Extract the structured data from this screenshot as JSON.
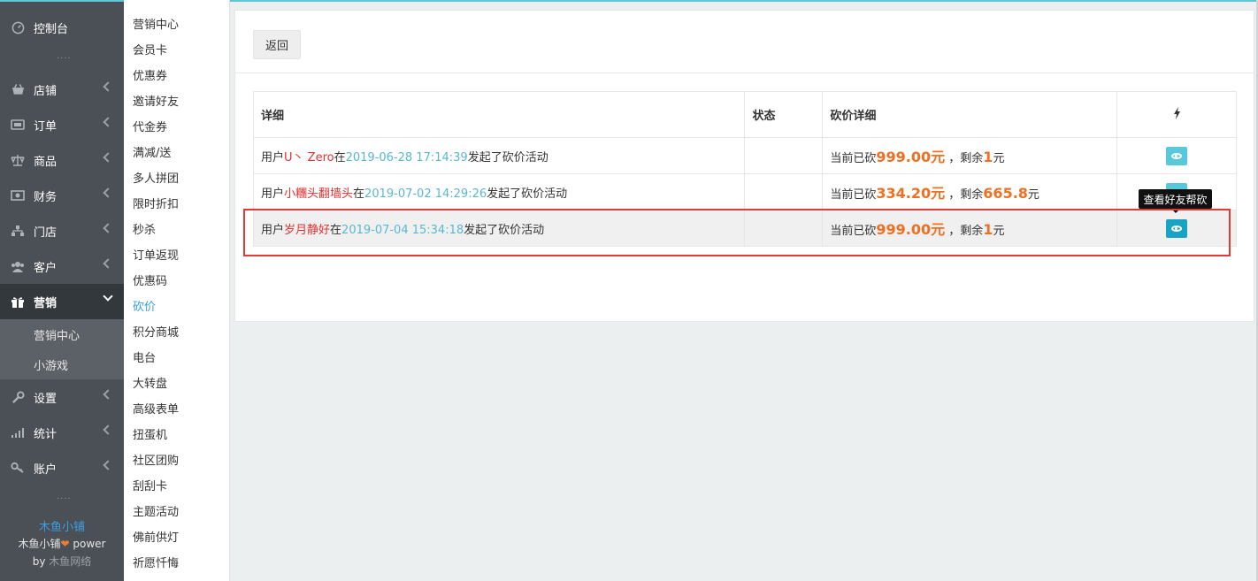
{
  "sidebar": {
    "dashboard": {
      "label": "控制台",
      "icon": "dashboard-icon"
    },
    "items": [
      {
        "label": "店铺",
        "icon": "shop-icon"
      },
      {
        "label": "订单",
        "icon": "order-icon"
      },
      {
        "label": "商品",
        "icon": "goods-icon"
      },
      {
        "label": "财务",
        "icon": "finance-icon"
      },
      {
        "label": "门店",
        "icon": "store-icon"
      },
      {
        "label": "客户",
        "icon": "customer-icon"
      },
      {
        "label": "营销",
        "icon": "gift-icon"
      },
      {
        "label": "设置",
        "icon": "wrench-icon"
      },
      {
        "label": "统计",
        "icon": "stats-icon"
      },
      {
        "label": "账户",
        "icon": "key-icon"
      }
    ],
    "sub_items": [
      "营销中心",
      "小游戏"
    ],
    "footer": {
      "brand": "木鱼小铺",
      "power_prefix": "木鱼小铺",
      "heart": "❤",
      "power_suffix": " power",
      "by_prefix": "by ",
      "by_company": "木鱼网络"
    },
    "dots": "...."
  },
  "submenu": {
    "items": [
      "营销中心",
      "会员卡",
      "优惠券",
      "邀请好友",
      "代金券",
      "满减/送",
      "多人拼团",
      "限时折扣",
      "秒杀",
      "订单返现",
      "优惠码",
      "砍价",
      "积分商城",
      "电台",
      "大转盘",
      "高级表单",
      "扭蛋机",
      "社区团购",
      "刮刮卡",
      "主题活动",
      "佛前供灯",
      "祈愿忏悔"
    ],
    "current": "砍价"
  },
  "toolbar": {
    "back_label": "返回"
  },
  "table": {
    "headers": {
      "detail": "详细",
      "status": "状态",
      "cut_detail": "砍价详细",
      "op_icon": "lightning-icon"
    },
    "rows": [
      {
        "prefix": "用户",
        "user": "U丶 Zero",
        "mid": "在",
        "time": "2019-06-28 17:14:39",
        "suffix": "发起了砍价活动",
        "status": "",
        "cut_prefix": "当前已砍",
        "cut_amount": "999.00元",
        "remain_prefix": "，剩余",
        "remain_amount": "1",
        "remain_suffix": "元"
      },
      {
        "prefix": "用户",
        "user": "小糰头翻墙头",
        "mid": "在",
        "time": "2019-07-02 14:29:26",
        "suffix": "发起了砍价活动",
        "status": "",
        "cut_prefix": "当前已砍",
        "cut_amount": "334.20元",
        "remain_prefix": "，剩余",
        "remain_amount": "665.8",
        "remain_suffix": "元"
      },
      {
        "prefix": "用户",
        "user": "岁月静好",
        "mid": "在",
        "time": "2019-07-04 15:34:18",
        "suffix": "发起了砍价活动",
        "status": "",
        "cut_prefix": "当前已砍",
        "cut_amount": "999.00元",
        "remain_prefix": "，剩余",
        "remain_amount": "1",
        "remain_suffix": "元"
      }
    ]
  },
  "tooltip": {
    "text": "查看好友帮砍"
  },
  "colors": {
    "accent": "#5fc6d9",
    "highlight_border": "#e53935",
    "amount": "#f07021",
    "username": "#e03131",
    "timestamp": "#5ab8cc"
  }
}
